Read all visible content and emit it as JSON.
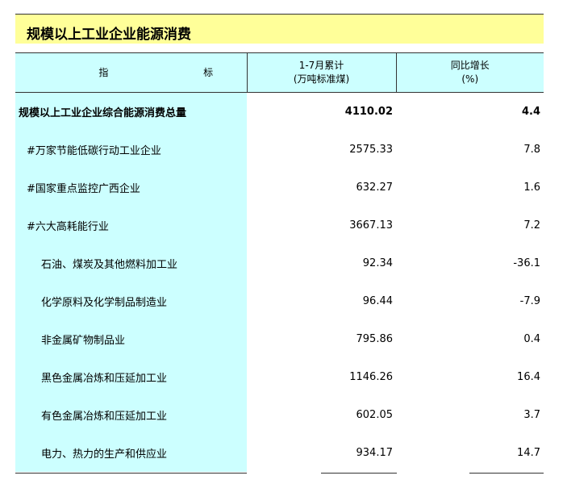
{
  "title": "规模以上工业企业能源消费",
  "header": {
    "indicator_left": "指",
    "indicator_right": "标",
    "col2_line1": "1-7月累计",
    "col2_line2": "(万吨标准煤)",
    "col3_line1": "同比增长",
    "col3_line2": "(%)"
  },
  "rows": [
    {
      "name": "规模以上工业企业综合能源消费总量",
      "value": "4110.02",
      "growth": "4.4"
    },
    {
      "name": "#万家节能低碳行动工业企业",
      "value": "2575.33",
      "growth": "7.8"
    },
    {
      "name": "#国家重点监控广西企业",
      "value": "632.27",
      "growth": "1.6"
    },
    {
      "name": "#六大高耗能行业",
      "value": "3667.13",
      "growth": "7.2"
    },
    {
      "name": "石油、煤炭及其他燃料加工业",
      "value": "92.34",
      "growth": "-36.1"
    },
    {
      "name": "化学原料及化学制品制造业",
      "value": "96.44",
      "growth": "-7.9"
    },
    {
      "name": "非金属矿物制品业",
      "value": "795.86",
      "growth": "0.4"
    },
    {
      "name": "黑色金属冶炼和压延加工业",
      "value": "1146.26",
      "growth": "16.4"
    },
    {
      "name": "有色金属冶炼和压延加工业",
      "value": "602.05",
      "growth": "3.7"
    },
    {
      "name": "电力、热力的生产和供应业",
      "value": "934.17",
      "growth": "14.7"
    }
  ]
}
